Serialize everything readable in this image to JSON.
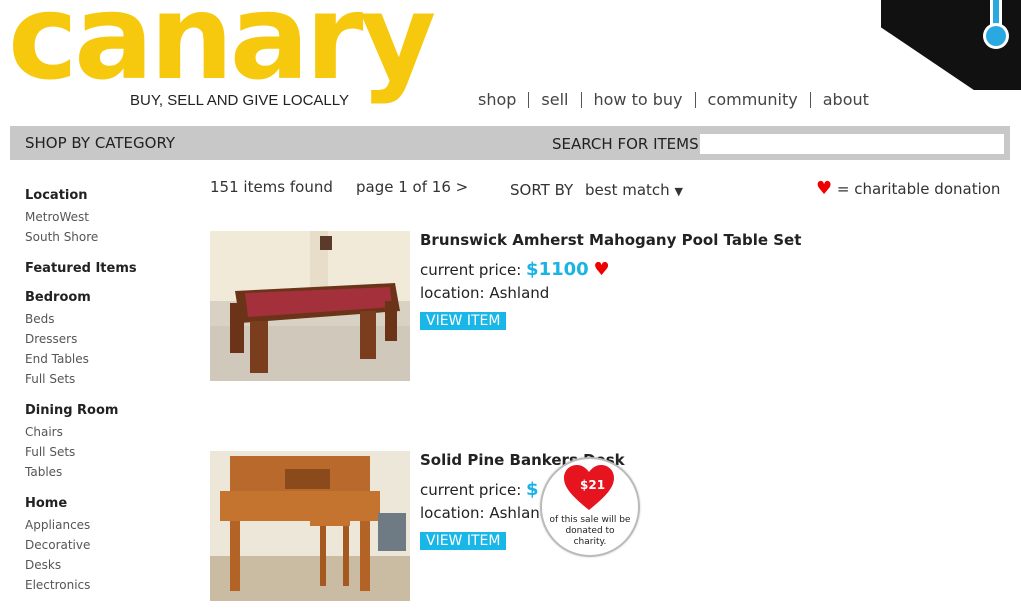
{
  "brand": {
    "logo": "canary",
    "tagline": "BUY, SELL AND GIVE LOCALLY"
  },
  "nav": [
    "shop",
    "sell",
    "how to buy",
    "community",
    "about"
  ],
  "catbar": {
    "shop_by": "SHOP BY CATEGORY",
    "search_label": "SEARCH FOR ITEMS",
    "search_value": ""
  },
  "sidebar": [
    {
      "head": "Location",
      "links": [
        "MetroWest",
        "South Shore"
      ]
    },
    {
      "head": "Featured Items",
      "links": []
    },
    {
      "head": "Bedroom",
      "links": [
        "Beds",
        "Dressers",
        "End Tables",
        "Full Sets"
      ]
    },
    {
      "head": "Dining Room",
      "links": [
        "Chairs",
        "Full Sets",
        "Tables"
      ]
    },
    {
      "head": "Home",
      "links": [
        "Appliances",
        "Decorative",
        "Desks",
        "Electronics"
      ]
    }
  ],
  "results": {
    "found": "151 items found",
    "page": "page 1 of 16 >",
    "sort_label": "SORT BY",
    "sort_value": "best match",
    "charity_note": "= charitable donation"
  },
  "listings": [
    {
      "title": "Brunswick Amherst Mahogany Pool Table Set",
      "price_label": "current price:",
      "price": "$1100",
      "location": "location: Ashland",
      "button": "VIEW ITEM"
    },
    {
      "title": "Solid Pine Bankers Desk",
      "price_label": "current price:",
      "price": "$",
      "location": "location: Ashland",
      "button": "VIEW ITEM"
    }
  ],
  "donation_badge": {
    "amount": "$21",
    "text": "of this sale will be donated to charity."
  },
  "colors": {
    "brand": "#f6c90e",
    "accent": "#1ab3e6",
    "heart": "#e00000",
    "bar": "#c8c8c8"
  }
}
